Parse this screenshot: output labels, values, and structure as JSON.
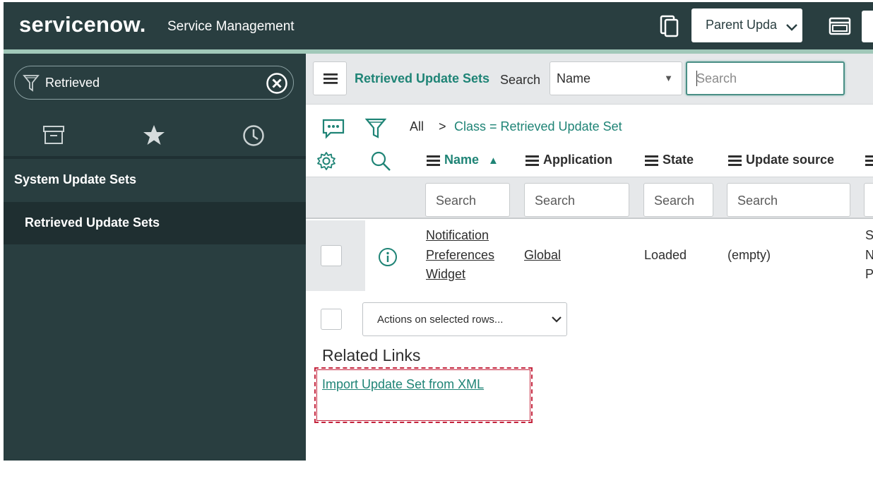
{
  "header": {
    "logo_text": "servicenow.",
    "product_name": "Service Management",
    "update_set_select": "Parent Upda",
    "bg_color": "#293e40"
  },
  "navigator": {
    "filter_value": "Retrieved",
    "tabs": [
      "archive-icon",
      "star-icon",
      "clock-icon"
    ],
    "section": "System Update Sets",
    "item": "Retrieved Update Sets"
  },
  "list": {
    "title": "Retrieved Update Sets",
    "search_label": "Search",
    "search_field": "Name",
    "search_placeholder": "Search",
    "breadcrumb_all": "All",
    "breadcrumb_sep": ">",
    "breadcrumb_filter": "Class = Retrieved Update Set",
    "columns": [
      "Name",
      "Application",
      "State",
      "Update source"
    ],
    "column_search_placeholder": "Search",
    "rows": [
      {
        "name_lines": [
          "Notification",
          "Preferences",
          "Widget"
        ],
        "application": "Global",
        "state": "Loaded",
        "update_source": "(empty)",
        "extra_col_lines": [
          "Se",
          "N",
          "P"
        ]
      }
    ],
    "actions_label": "Actions on selected rows..."
  },
  "related_links": {
    "title": "Related Links",
    "links": [
      "Import Update Set from XML"
    ]
  },
  "accent_color": "#1f8476"
}
